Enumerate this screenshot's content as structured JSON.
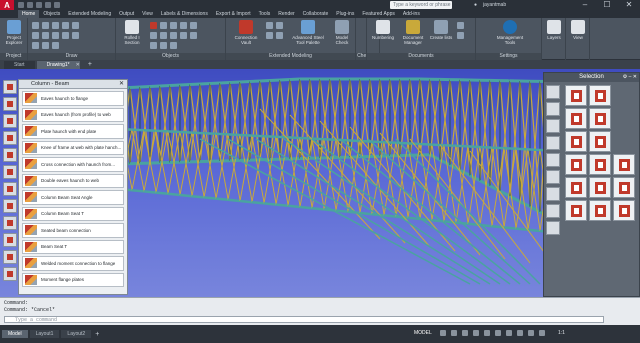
{
  "titlebar": {
    "search_placeholder": "Type a keyword or phrase",
    "user": "jayantmab"
  },
  "ribbon_tabs": [
    "Home",
    "Objects",
    "Extended Modeling",
    "Output",
    "View",
    "Labels & Dimensions",
    "Export & Import",
    "Tools",
    "Render",
    "Collaborate",
    "Plug-ins",
    "Featured Apps",
    "Add-ins"
  ],
  "ribbon": {
    "project_explorer": "Project Explorer",
    "project_panel": "Project",
    "draw_panel": "Draw",
    "rolled_section": "Rolled I Section",
    "objects_panel": "Objects",
    "connection_vault": "Connection Vault",
    "advanced_steel_tool_palette": "Advanced Steel Tool Palette",
    "model_check": "Model Check",
    "extended_modeling_panel": "Extended Modeling",
    "numbering": "Numbering",
    "document_manager": "Document Manager",
    "create_lists": "Create lists",
    "checking_panel": "Checking",
    "documents_panel": "Documents",
    "management_tools": "Management Tools",
    "settings_panel": "Settings",
    "layers": "Layers",
    "view": "View"
  },
  "doc_tabs": {
    "start": "Start",
    "drawing": "Drawing1*"
  },
  "palette": {
    "title": "Column - Beam",
    "items": [
      "Eaves haunch to flange",
      "Eaves haunch (from profile) to web",
      "Plate haunch with end plate",
      "Knee of frame at web with plate hanch...",
      "Cross connection with haunch from...",
      "Double eaves haunch to web",
      "Column Beam Seat Angle",
      "Column Beam Seat T",
      "Seated beam connection",
      "Beam Seat T",
      "Welded moment connection to flange",
      "Moment flange plates"
    ]
  },
  "selection": {
    "title": "Selection"
  },
  "command": {
    "line1": "Command:",
    "line2": "Command: *Cancel*",
    "placeholder": "Type a command"
  },
  "status": {
    "layouts": [
      "Model",
      "Layout1",
      "Layout2"
    ],
    "model_label": "MODEL",
    "scale": "1:1"
  },
  "colors": {
    "viewport_top": "#3f4cc0",
    "truss_yellow": "#c9a93a",
    "truss_teal": "#4aa3a0"
  }
}
